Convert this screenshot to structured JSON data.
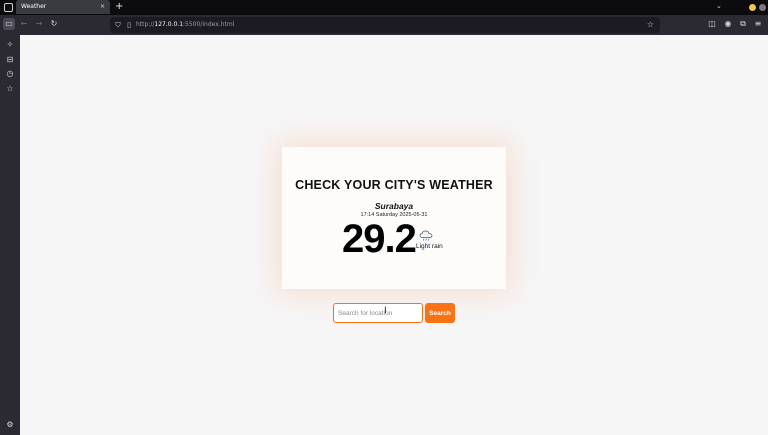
{
  "browser": {
    "tab_title": "Weather",
    "tab_close": "×",
    "new_tab": "+",
    "url_host": "127.0.0.1",
    "url_rest": ":5500/index.html",
    "url_prefix": "http://",
    "icons": [
      "sidebar-toggle-icon",
      "back-icon",
      "forward-icon",
      "reload-icon",
      "shield-icon",
      "page-icon",
      "bookmark-star-icon",
      "pocket-icon",
      "account-icon",
      "extensions-icon",
      "menu-icon"
    ]
  },
  "sidebar": {
    "icons": [
      "ai-chat-icon",
      "synced-tabs-icon",
      "history-icon",
      "bookmarks-icon",
      "settings-icon"
    ]
  },
  "weather": {
    "title": "CHECK YOUR CITY'S WEATHER",
    "city": "Surabaya",
    "datetime": "17:14 Saturday 2025-05-31",
    "temperature": "29.2",
    "condition": "Light rain",
    "icon": "light-rain-icon"
  },
  "search": {
    "placeholder": "Search for location",
    "button_label": "Search"
  },
  "colors": {
    "accent": "#f97316",
    "chrome_dark": "#2b2a33",
    "tab_strip": "#0c0c0e"
  }
}
